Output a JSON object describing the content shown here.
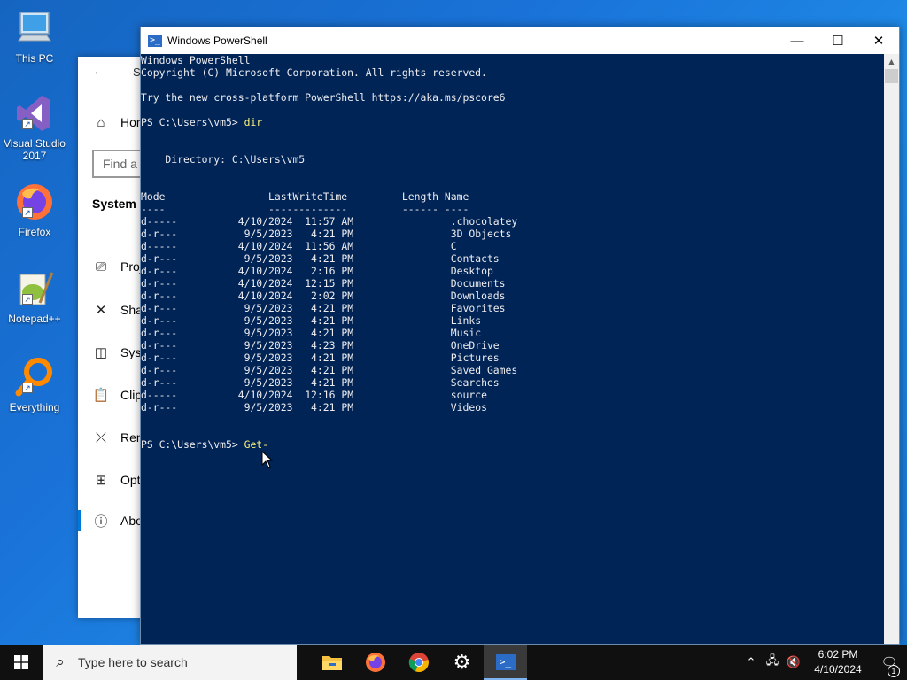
{
  "desktop": {
    "icons": [
      {
        "label": "This PC",
        "icon": "computer-icon"
      },
      {
        "label": "Visual Studio\n2017",
        "icon": "visual-studio-icon"
      },
      {
        "label": "Firefox",
        "icon": "firefox-icon"
      },
      {
        "label": "Notepad++",
        "icon": "notepad-plus-plus-icon"
      },
      {
        "label": "Everything",
        "icon": "everything-search-icon"
      }
    ]
  },
  "settings": {
    "title_fragment": "S",
    "home_label": "Hor",
    "search_placeholder": "Find a s",
    "section": "System",
    "nav": [
      {
        "label": "Proj",
        "icon": "projector-icon"
      },
      {
        "label": "Sha",
        "icon": "share-icon"
      },
      {
        "label": "Syst",
        "icon": "multitasking-icon"
      },
      {
        "label": "Clip",
        "icon": "clipboard-icon"
      },
      {
        "label": "Rem",
        "icon": "remote-desktop-icon"
      },
      {
        "label": "Opt",
        "icon": "optional-features-icon"
      },
      {
        "label": "Abo",
        "icon": "info-icon"
      }
    ]
  },
  "powershell": {
    "title": "Windows PowerShell",
    "header_lines": [
      "Windows PowerShell",
      "Copyright (C) Microsoft Corporation. All rights reserved.",
      "",
      "Try the new cross-platform PowerShell https://aka.ms/pscore6",
      ""
    ],
    "prompt": "PS C:\\Users\\vm5> ",
    "command1": "dir",
    "directory_line": "    Directory: C:\\Users\\vm5",
    "column_header": "Mode                 LastWriteTime         Length Name",
    "column_rule": "----                 -------------         ------ ----",
    "entries": [
      {
        "mode": "d-----",
        "date": "4/10/2024",
        "time": "11:57 AM",
        "name": ".chocolatey"
      },
      {
        "mode": "d-r---",
        "date": "9/5/2023",
        "time": "4:21 PM",
        "name": "3D Objects"
      },
      {
        "mode": "d-----",
        "date": "4/10/2024",
        "time": "11:56 AM",
        "name": "C"
      },
      {
        "mode": "d-r---",
        "date": "9/5/2023",
        "time": "4:21 PM",
        "name": "Contacts"
      },
      {
        "mode": "d-r---",
        "date": "4/10/2024",
        "time": "2:16 PM",
        "name": "Desktop"
      },
      {
        "mode": "d-r---",
        "date": "4/10/2024",
        "time": "12:15 PM",
        "name": "Documents"
      },
      {
        "mode": "d-r---",
        "date": "4/10/2024",
        "time": "2:02 PM",
        "name": "Downloads"
      },
      {
        "mode": "d-r---",
        "date": "9/5/2023",
        "time": "4:21 PM",
        "name": "Favorites"
      },
      {
        "mode": "d-r---",
        "date": "9/5/2023",
        "time": "4:21 PM",
        "name": "Links"
      },
      {
        "mode": "d-r---",
        "date": "9/5/2023",
        "time": "4:21 PM",
        "name": "Music"
      },
      {
        "mode": "d-r---",
        "date": "9/5/2023",
        "time": "4:23 PM",
        "name": "OneDrive"
      },
      {
        "mode": "d-r---",
        "date": "9/5/2023",
        "time": "4:21 PM",
        "name": "Pictures"
      },
      {
        "mode": "d-r---",
        "date": "9/5/2023",
        "time": "4:21 PM",
        "name": "Saved Games"
      },
      {
        "mode": "d-r---",
        "date": "9/5/2023",
        "time": "4:21 PM",
        "name": "Searches"
      },
      {
        "mode": "d-----",
        "date": "4/10/2024",
        "time": "12:16 PM",
        "name": "source"
      },
      {
        "mode": "d-r---",
        "date": "9/5/2023",
        "time": "4:21 PM",
        "name": "Videos"
      }
    ],
    "command2": "Get-"
  },
  "taskbar": {
    "search_placeholder": "Type here to search",
    "apps": [
      "file-explorer-icon",
      "firefox-icon",
      "chrome-icon",
      "settings-gear-icon",
      "powershell-icon"
    ],
    "time": "6:02 PM",
    "date": "4/10/2024",
    "notification_count": "1"
  },
  "colors": {
    "console_bg": "#012456",
    "console_text": "#eeedf0",
    "command_text": "#fcf27a",
    "accent": "#0078d7"
  }
}
